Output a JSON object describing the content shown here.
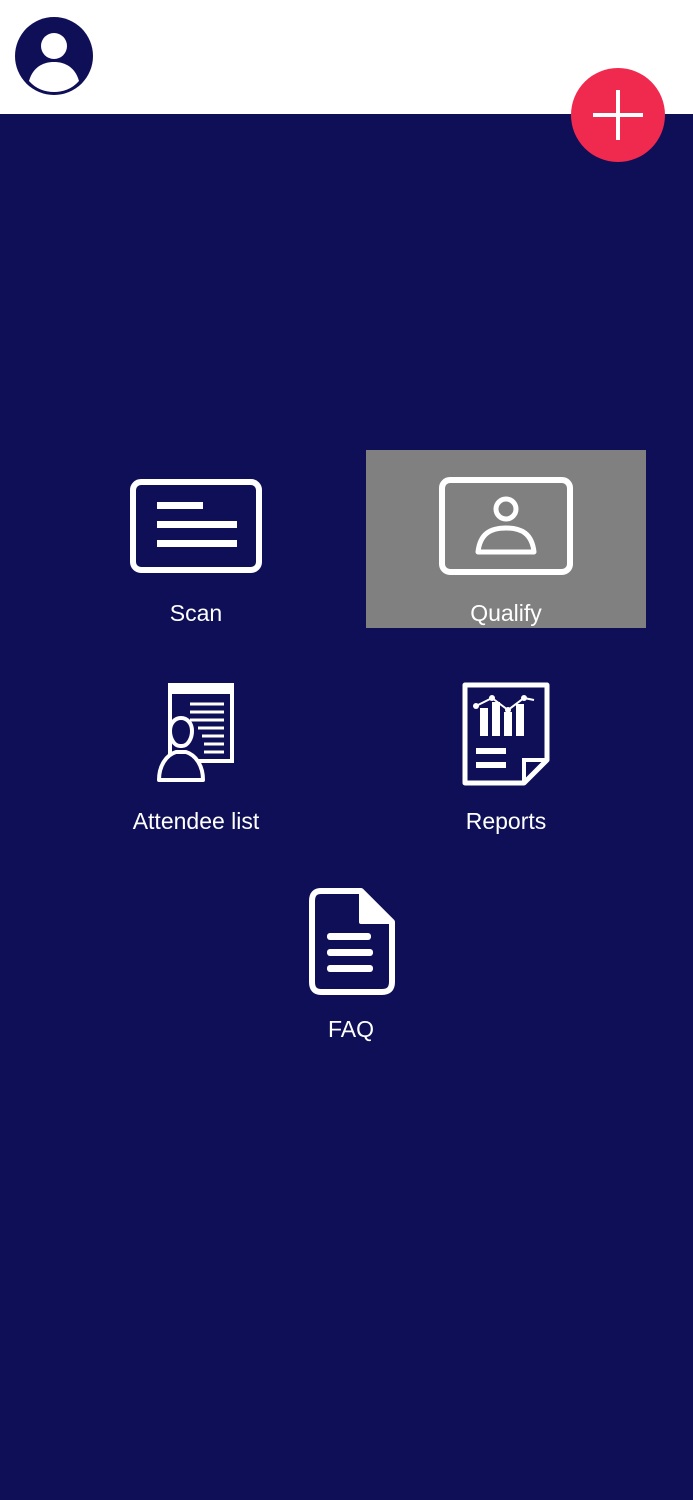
{
  "header": {
    "avatar_icon": "user-avatar-icon",
    "add_icon": "plus-icon"
  },
  "menu": {
    "scan": {
      "label": "Scan",
      "icon": "card-icon"
    },
    "qualify": {
      "label": "Qualify",
      "icon": "contact-card-icon",
      "selected": true
    },
    "attendee_list": {
      "label": "Attendee list",
      "icon": "attendee-list-icon"
    },
    "reports": {
      "label": "Reports",
      "icon": "report-chart-icon"
    },
    "faq": {
      "label": "FAQ",
      "icon": "document-icon"
    }
  },
  "colors": {
    "background": "#0f0f57",
    "header": "#ffffff",
    "accent": "#f0294f",
    "selected_tile": "#808080",
    "icon": "#ffffff"
  }
}
